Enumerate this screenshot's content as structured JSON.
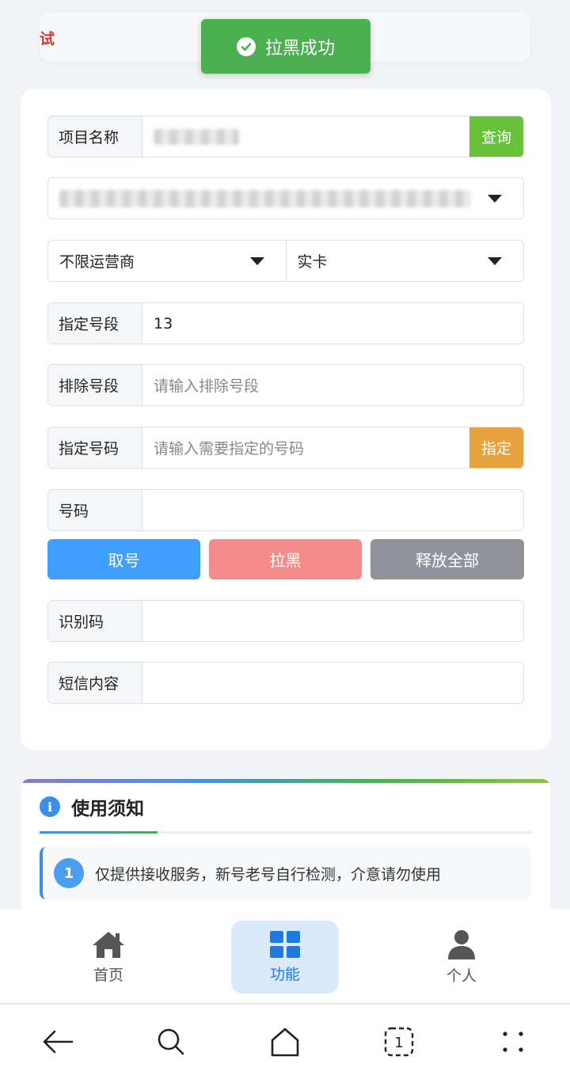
{
  "top_notice": {
    "text": "试"
  },
  "toast": {
    "text": "拉黑成功"
  },
  "form": {
    "project_label": "项目名称",
    "query_button": "查询",
    "operator_select": "不限运营商",
    "card_type_select": "实卡",
    "segment_label": "指定号段",
    "segment_value": "13",
    "exclude_label": "排除号段",
    "exclude_placeholder": "请输入排除号段",
    "specify_label": "指定号码",
    "specify_placeholder": "请输入需要指定的号码",
    "specify_button": "指定",
    "number_label": "号码",
    "number_value": "",
    "code_label": "识别码",
    "code_value": "",
    "sms_label": "短信内容",
    "sms_value": ""
  },
  "actions": {
    "get_number": "取号",
    "blacklist": "拉黑",
    "release_all": "释放全部"
  },
  "notice_card": {
    "title": "使用须知",
    "items": [
      {
        "num": "1",
        "text": "仅提供接收服务，新号老号自行检测，介意请勿使用"
      }
    ]
  },
  "tabbar": {
    "home": "首页",
    "features": "功能",
    "profile": "个人"
  },
  "colors": {
    "query_green": "#67c23a",
    "specify_orange": "#e6a23c",
    "primary_blue": "#409eff",
    "danger_light": "#f48c8c",
    "gray_button": "#909399",
    "toast_green": "#4caf50"
  }
}
